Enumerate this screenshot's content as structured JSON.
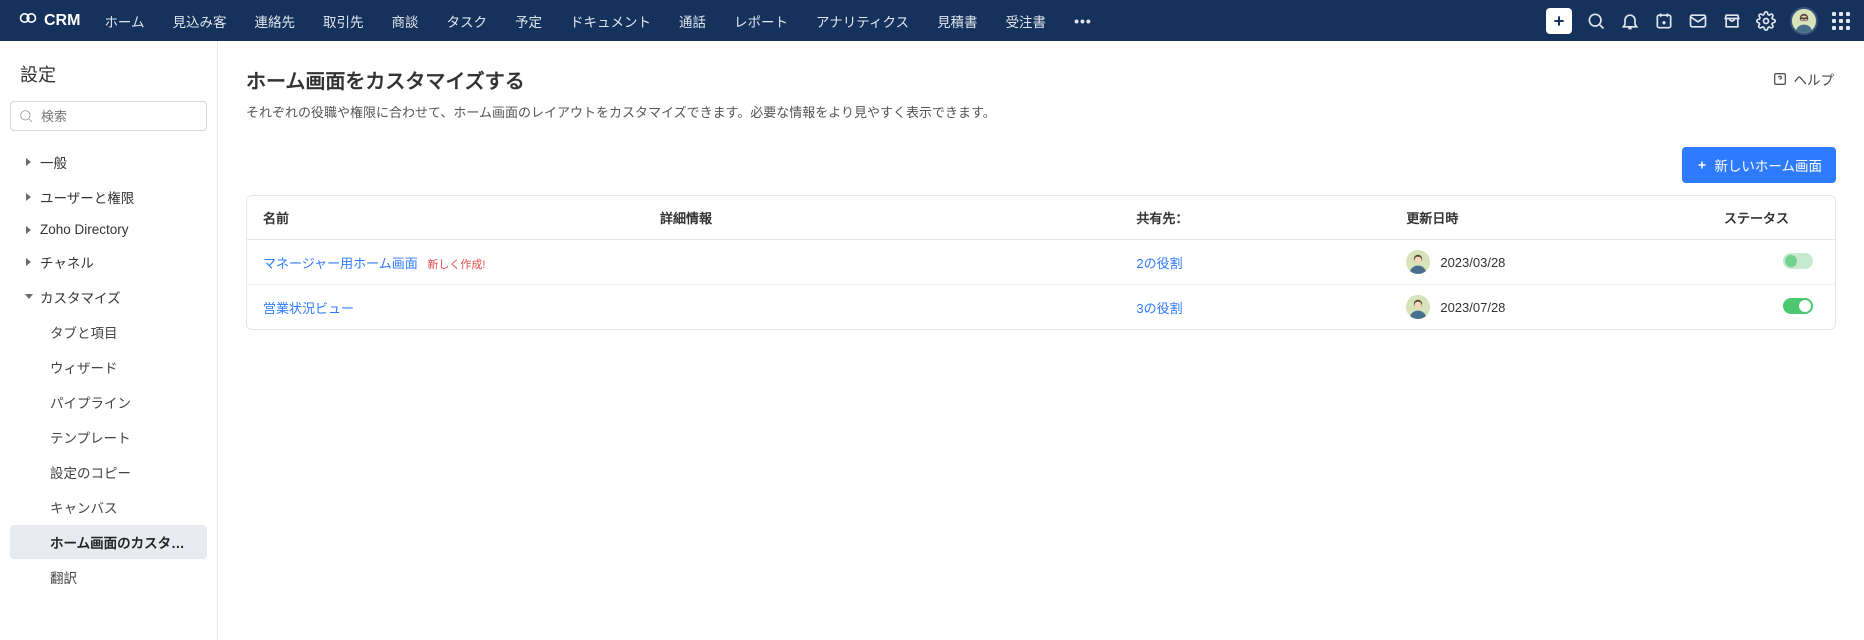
{
  "brand": "CRM",
  "nav": {
    "items": [
      "ホーム",
      "見込み客",
      "連絡先",
      "取引先",
      "商談",
      "タスク",
      "予定",
      "ドキュメント",
      "通話",
      "レポート",
      "アナリティクス",
      "見積書",
      "受注書"
    ],
    "more": "•••"
  },
  "sidebar": {
    "title": "設定",
    "search_placeholder": "検索",
    "sections": [
      {
        "label": "一般",
        "expanded": false
      },
      {
        "label": "ユーザーと権限",
        "expanded": false
      },
      {
        "label": "Zoho Directory",
        "expanded": false
      },
      {
        "label": "チャネル",
        "expanded": false
      },
      {
        "label": "カスタマイズ",
        "expanded": true,
        "children": [
          {
            "label": "タブと項目",
            "selected": false
          },
          {
            "label": "ウィザード",
            "selected": false
          },
          {
            "label": "パイプライン",
            "selected": false
          },
          {
            "label": "テンプレート",
            "selected": false
          },
          {
            "label": "設定のコピー",
            "selected": false
          },
          {
            "label": "キャンバス",
            "selected": false
          },
          {
            "label": "ホーム画面のカスタマイ...",
            "selected": true
          },
          {
            "label": "翻訳",
            "selected": false
          }
        ]
      }
    ]
  },
  "main": {
    "title": "ホーム画面をカスタマイズする",
    "description": "それぞれの役職や権限に合わせて、ホーム画面のレイアウトをカスタマイズできます。必要な情報をより見やすく表示できます。",
    "help": "ヘルプ",
    "new_button": "新しいホーム画面",
    "table": {
      "headers": {
        "name": "名前",
        "detail": "詳細情報",
        "share": "共有先：",
        "updated": "更新日時",
        "status": "ステータス"
      },
      "rows": [
        {
          "name": "マネージャー用ホーム画面",
          "new_badge": "新しく作成!",
          "detail": "",
          "share": "2の役割",
          "updated": "2023/03/28",
          "status_on": false
        },
        {
          "name": "営業状況ビュー",
          "new_badge": "",
          "detail": "",
          "share": "3の役割",
          "updated": "2023/07/28",
          "status_on": true
        }
      ]
    }
  }
}
